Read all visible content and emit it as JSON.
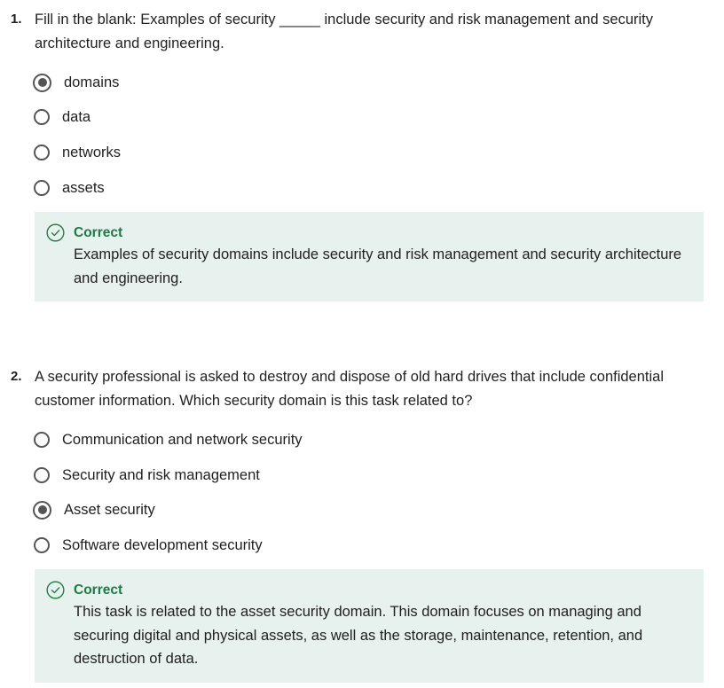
{
  "questions": [
    {
      "number": "1.",
      "prompt": "Fill in the blank: Examples of security _____ include security and risk management and security architecture and engineering.",
      "options": [
        {
          "label": "domains",
          "selected": true
        },
        {
          "label": "data",
          "selected": false
        },
        {
          "label": "networks",
          "selected": false
        },
        {
          "label": "assets",
          "selected": false
        }
      ],
      "feedback": {
        "status": "Correct",
        "text": "Examples of security domains include security and risk management and security architecture and engineering.",
        "icon": "check-circle-icon"
      }
    },
    {
      "number": "2.",
      "prompt": "A security professional is asked to destroy and dispose of old hard drives that include confidential customer information. Which security domain is this task related to?",
      "options": [
        {
          "label": "Communication and network security",
          "selected": false
        },
        {
          "label": "Security and risk management",
          "selected": false
        },
        {
          "label": "Asset security",
          "selected": true
        },
        {
          "label": "Software development security",
          "selected": false
        }
      ],
      "feedback": {
        "status": "Correct",
        "text": "This task is related to the asset security domain. This domain focuses on managing and securing digital and physical assets, as well as the storage, maintenance, retention, and destruction of data.",
        "icon": "check-circle-icon"
      }
    }
  ],
  "colors": {
    "correct_green": "#1d7a45",
    "feedback_bg": "#e7f1ed",
    "radio_border": "#555555"
  }
}
